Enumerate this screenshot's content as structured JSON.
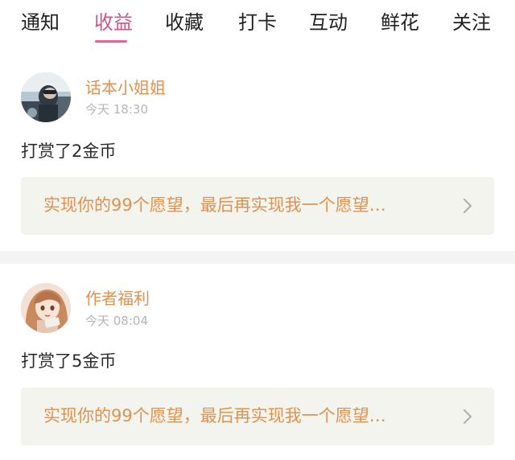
{
  "tabs": [
    {
      "label": "通知",
      "active": false
    },
    {
      "label": "收益",
      "active": true
    },
    {
      "label": "收藏",
      "active": false
    },
    {
      "label": "打卡",
      "active": false
    },
    {
      "label": "互动",
      "active": false
    },
    {
      "label": "鲜花",
      "active": false
    },
    {
      "label": "关注",
      "active": false
    }
  ],
  "feed": [
    {
      "user": "话本小姐姐",
      "time": "今天 18:30",
      "reward": "打赏了2金币",
      "quote": "实现你的99个愿望，最后再实现我一个愿望…",
      "avatar_icon": "user-photo-avatar-icon"
    },
    {
      "user": "作者福利",
      "time": "今天 08:04",
      "reward": "打赏了5金币",
      "quote": "实现你的99个愿望，最后再实现我一个愿望…",
      "avatar_icon": "anime-girl-avatar-icon"
    }
  ],
  "colors": {
    "tab_active": "#c65a8a",
    "underline": "#d56a98",
    "accent_orange": "#e0914f",
    "timestamp_gray": "#b5b5b5",
    "card_bg": "#f3f4ee",
    "divider_bg": "#f4f4f4"
  }
}
